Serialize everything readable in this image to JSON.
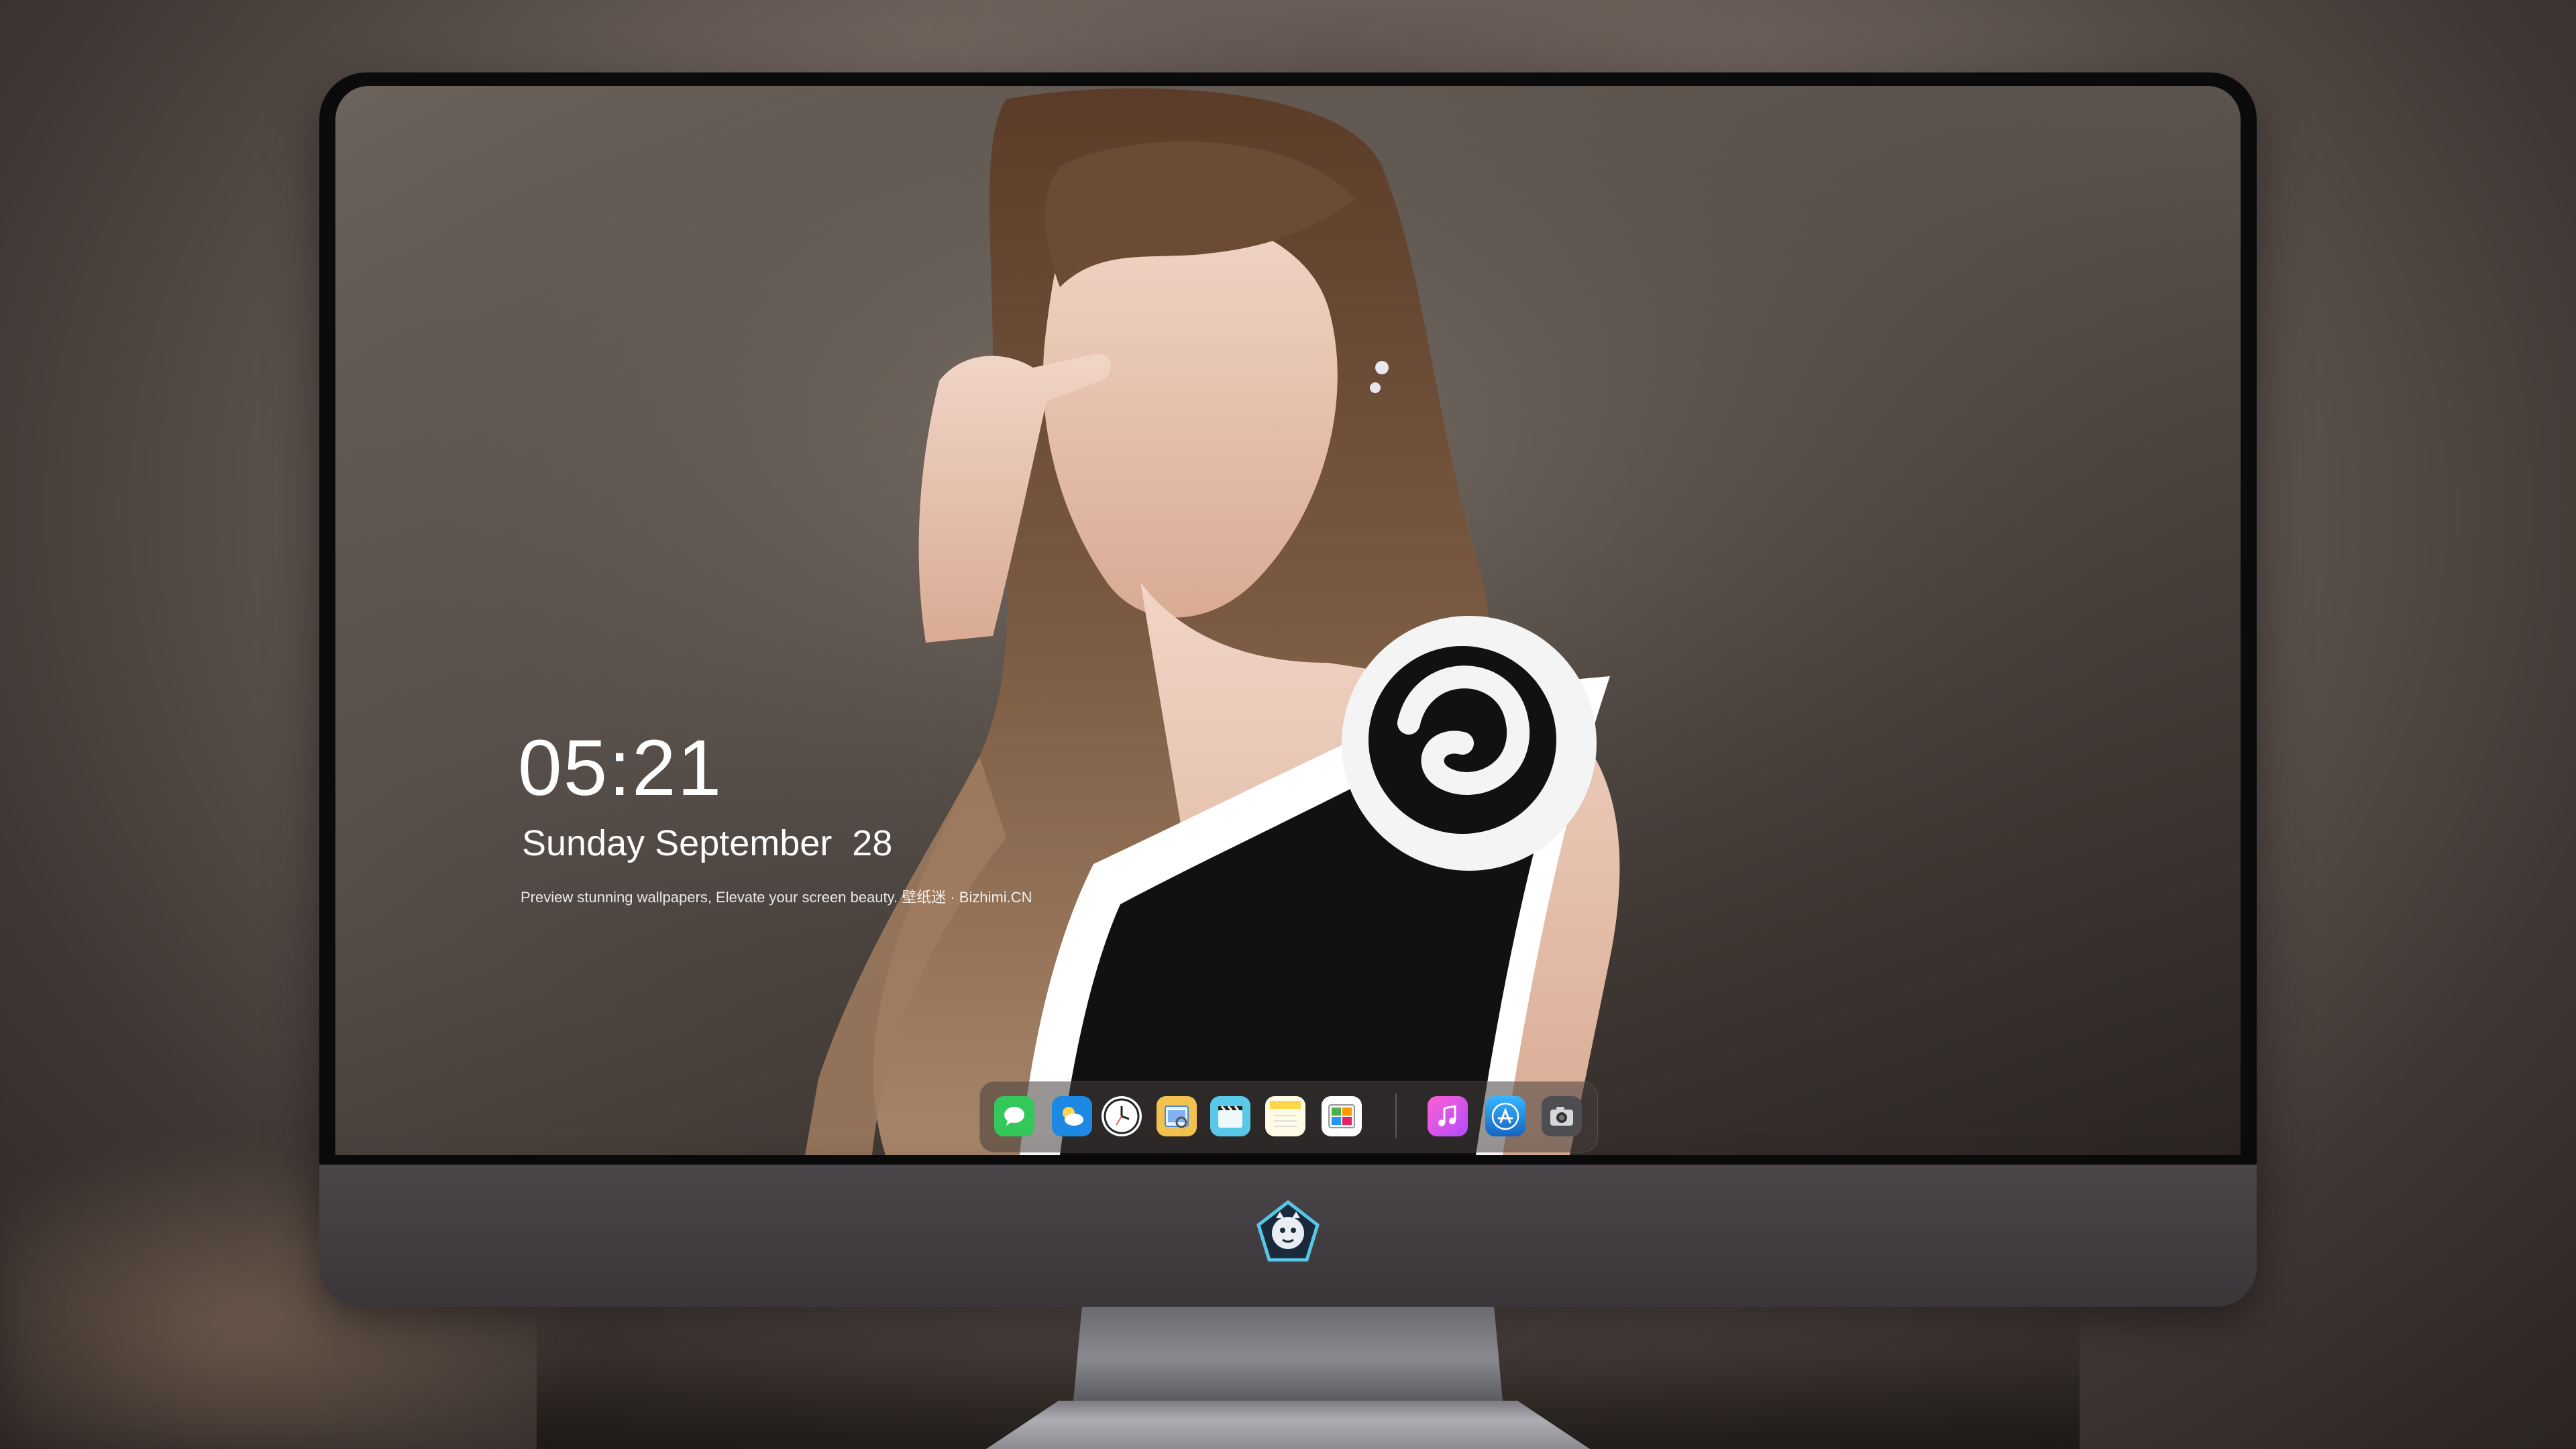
{
  "lock_screen": {
    "time": "05:21",
    "date": "Sunday September  28",
    "tagline": "Preview stunning wallpapers, Elevate your screen beauty. 壁纸迷 · Bizhimi.CN"
  },
  "dock": {
    "apps": [
      {
        "name": "messages-icon",
        "color": "#34c759"
      },
      {
        "name": "weather-icon",
        "color": "#1e88e5"
      },
      {
        "name": "clock-icon",
        "color": "#ffffff"
      },
      {
        "name": "preview-icon",
        "color": "#f2c14e"
      },
      {
        "name": "video-clips-icon",
        "color": "#5ac8e8"
      },
      {
        "name": "notes-icon",
        "color": "#ffd54a"
      },
      {
        "name": "photo-booth-icon",
        "color": "#ffffff"
      },
      {
        "name": "music-icon",
        "color": "#ff4fd8"
      },
      {
        "name": "app-store-icon",
        "color": "#1f8ef1"
      },
      {
        "name": "camera-icon",
        "color": "#555555"
      }
    ]
  },
  "colors": {
    "accent": "#ffffff",
    "monitor_chin": "#3f3a3d",
    "bezel": "#0b0b0c"
  }
}
